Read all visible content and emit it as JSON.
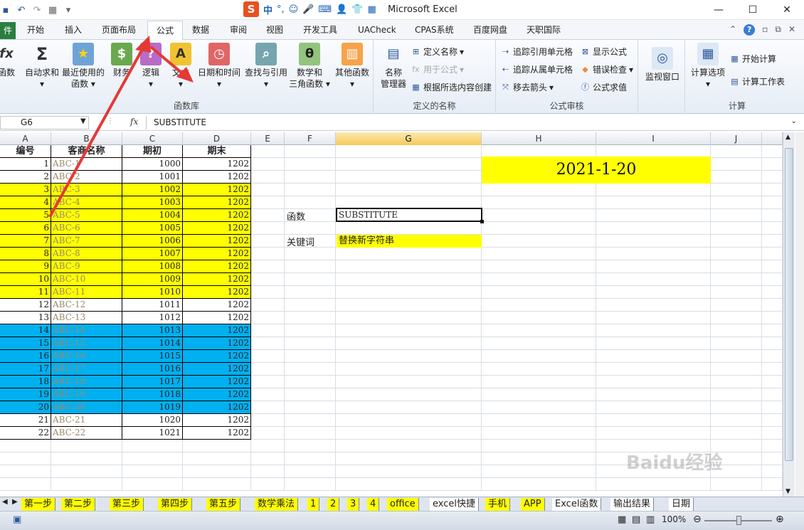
{
  "title": "Microsoft Excel",
  "ime": {
    "s": "S",
    "mode": "中"
  },
  "file_tab": "件",
  "tabs": [
    "开始",
    "插入",
    "页面布局",
    "公式",
    "数据",
    "审阅",
    "视图",
    "开发工具",
    "UACheck",
    "CPAS系统",
    "百度网盘",
    "天职国际"
  ],
  "ribbon": {
    "insert_func": "函数",
    "autosum": "自动求和",
    "recent": "最近使用的",
    "recent2": "函数",
    "finance": "财务",
    "logic": "逻辑",
    "text": "文本",
    "datetime": "日期和时间",
    "lookup": "查找与引用",
    "math": "数学和",
    "math2": "三角函数",
    "other": "其他函数",
    "lib_label": "函数库",
    "name_mgr": "名称",
    "name_mgr2": "管理器",
    "define_name": "定义名称",
    "use_in_formula": "用于公式",
    "create_from_sel": "根据所选内容创建",
    "names_label": "定义的名称",
    "trace_prec": "追踪引用单元格",
    "trace_dep": "追踪从属单元格",
    "remove_arrows": "移去箭头",
    "show_formulas": "显示公式",
    "error_check": "错误检查",
    "eval_formula": "公式求值",
    "audit_label": "公式审核",
    "watch": "监视窗口",
    "calc_opts": "计算选项",
    "calc_now": "开始计算",
    "calc_sheet": "计算工作表",
    "calc_label": "计算"
  },
  "namebox": "G6",
  "formula": "SUBSTITUTE",
  "columns": [
    "A",
    "B",
    "C",
    "D",
    "E",
    "F",
    "G",
    "H",
    "I",
    "J"
  ],
  "headers": [
    "编号",
    "客商名称",
    "期初",
    "期末"
  ],
  "rows": [
    {
      "n": "1",
      "name": "ABC-1",
      "a": "1000",
      "b": "1202",
      "fill": "none"
    },
    {
      "n": "2",
      "name": "ABC-2",
      "a": "1001",
      "b": "1202",
      "fill": "none"
    },
    {
      "n": "3",
      "name": "ABC-3",
      "a": "1002",
      "b": "1202",
      "fill": "yellow"
    },
    {
      "n": "4",
      "name": "ABC-4",
      "a": "1003",
      "b": "1202",
      "fill": "yellow"
    },
    {
      "n": "5",
      "name": "ABC-5",
      "a": "1004",
      "b": "1202",
      "fill": "yellow"
    },
    {
      "n": "6",
      "name": "ABC-6",
      "a": "1005",
      "b": "1202",
      "fill": "yellow"
    },
    {
      "n": "7",
      "name": "ABC-7",
      "a": "1006",
      "b": "1202",
      "fill": "yellow"
    },
    {
      "n": "8",
      "name": "ABC-8",
      "a": "1007",
      "b": "1202",
      "fill": "yellow"
    },
    {
      "n": "9",
      "name": "ABC-9",
      "a": "1008",
      "b": "1202",
      "fill": "yellow"
    },
    {
      "n": "10",
      "name": "ABC-10",
      "a": "1009",
      "b": "1202",
      "fill": "yellow"
    },
    {
      "n": "11",
      "name": "ABC-11",
      "a": "1010",
      "b": "1202",
      "fill": "yellow"
    },
    {
      "n": "12",
      "name": "ABC-12",
      "a": "1011",
      "b": "1202",
      "fill": "none"
    },
    {
      "n": "13",
      "name": "ABC-13",
      "a": "1012",
      "b": "1202",
      "fill": "none"
    },
    {
      "n": "14",
      "name": "ABC-14",
      "a": "1013",
      "b": "1202",
      "fill": "blue"
    },
    {
      "n": "15",
      "name": "ABC-15",
      "a": "1014",
      "b": "1202",
      "fill": "blue"
    },
    {
      "n": "16",
      "name": "ABC-16",
      "a": "1015",
      "b": "1202",
      "fill": "blue"
    },
    {
      "n": "17",
      "name": "ABC-17",
      "a": "1016",
      "b": "1202",
      "fill": "blue"
    },
    {
      "n": "18",
      "name": "ABC-18",
      "a": "1017",
      "b": "1202",
      "fill": "blue"
    },
    {
      "n": "19",
      "name": "ABC-19",
      "a": "1018",
      "b": "1202",
      "fill": "blue"
    },
    {
      "n": "20",
      "name": "ABC-20",
      "a": "1019",
      "b": "1202",
      "fill": "blue"
    },
    {
      "n": "21",
      "name": "ABC-21",
      "a": "1020",
      "b": "1202",
      "fill": "none"
    },
    {
      "n": "22",
      "name": "ABC-22",
      "a": "1021",
      "b": "1202",
      "fill": "none"
    }
  ],
  "date_cell": "2021-1-20",
  "label_func": "函数",
  "label_key": "关键词",
  "g6_value": "SUBSTITUTE",
  "g8_value": "替换新字符串",
  "sheets": [
    {
      "label": "第一步",
      "fill": "yellow"
    },
    {
      "label": "第二步",
      "fill": "yellow"
    },
    {
      "label": "第三步",
      "fill": "yellow"
    },
    {
      "label": "第四步",
      "fill": "yellow"
    },
    {
      "label": "第五步",
      "fill": "yellow"
    },
    {
      "label": "数学乘法",
      "fill": "yellow"
    },
    {
      "label": "1",
      "fill": "yellow"
    },
    {
      "label": "2",
      "fill": "yellow"
    },
    {
      "label": "3",
      "fill": "yellow"
    },
    {
      "label": "4",
      "fill": "yellow"
    },
    {
      "label": "office",
      "fill": "yellow"
    },
    {
      "label": "excel快捷",
      "fill": "white"
    },
    {
      "label": "手机",
      "fill": "yellow"
    },
    {
      "label": "APP",
      "fill": "yellow"
    },
    {
      "label": "Excel函数",
      "fill": "active"
    },
    {
      "label": "输出结果",
      "fill": "white"
    },
    {
      "label": "日期",
      "fill": "white"
    }
  ],
  "zoom": "100%",
  "watermark": "Baidu经验",
  "colors": {
    "yellow": "#ffff00",
    "blue": "#00b0f0",
    "arrow": "#e53935",
    "excel_green": "#2a7f3f"
  }
}
